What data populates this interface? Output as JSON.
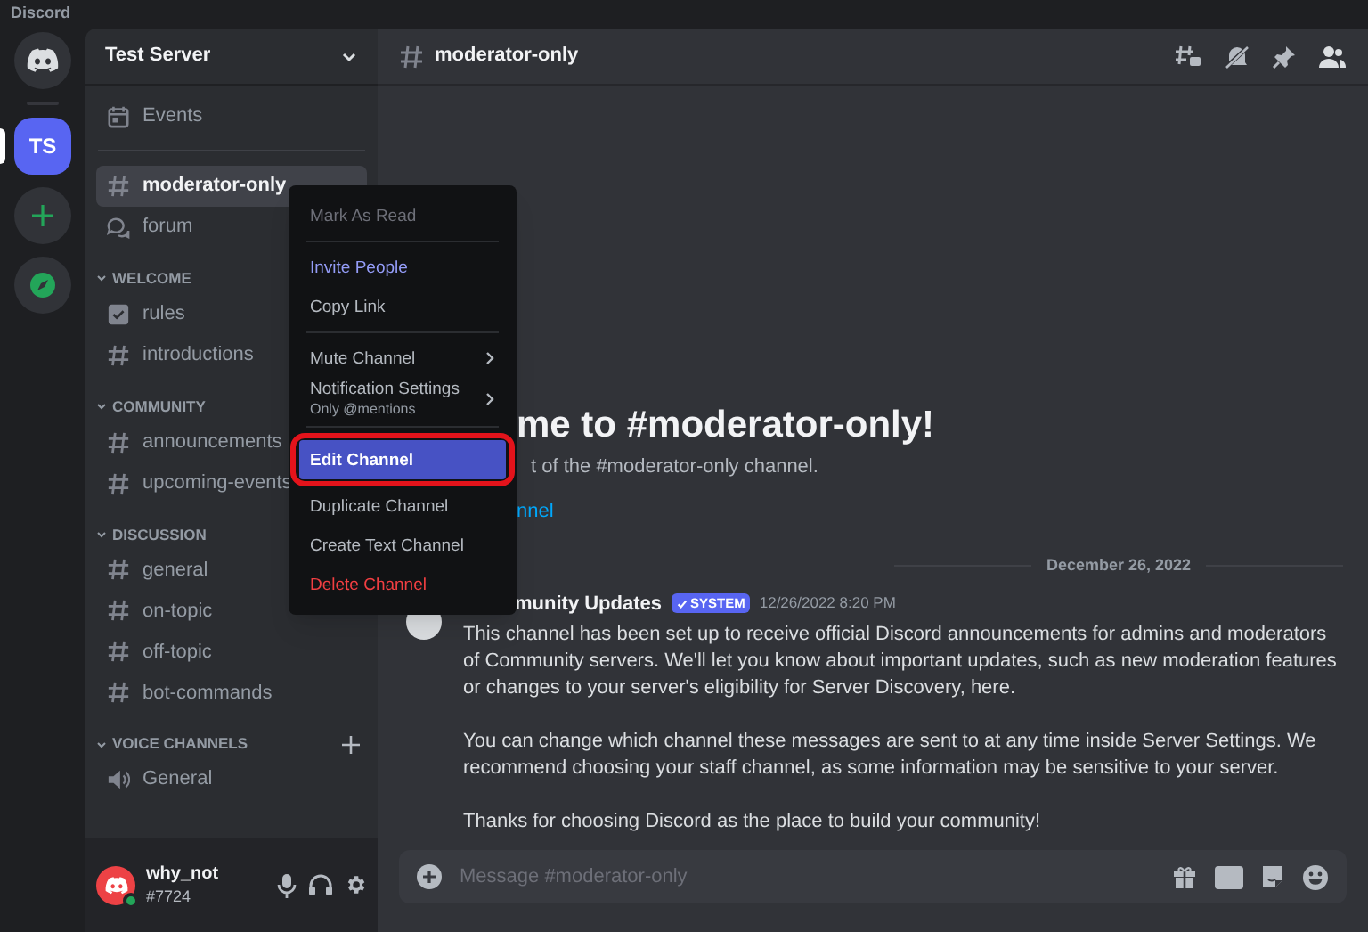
{
  "app_title": "Discord",
  "servers": [
    {
      "kind": "home",
      "selected": false
    },
    {
      "kind": "server",
      "label": "TS",
      "selected": true
    },
    {
      "kind": "add",
      "selected": false
    },
    {
      "kind": "explore",
      "selected": false
    }
  ],
  "server_name": "Test Server",
  "top_items": [
    {
      "kind": "events",
      "label": "Events"
    }
  ],
  "channels": [
    {
      "kind": "text",
      "label": "moderator-only",
      "selected": true
    },
    {
      "kind": "forum",
      "label": "forum",
      "selected": false
    }
  ],
  "categories": [
    {
      "label": "WELCOME",
      "channels": [
        {
          "kind": "rules",
          "label": "rules",
          "selected": false
        },
        {
          "kind": "text",
          "label": "introductions",
          "selected": false
        }
      ]
    },
    {
      "label": "COMMUNITY",
      "channels": [
        {
          "kind": "text",
          "label": "announcements",
          "selected": false
        },
        {
          "kind": "text",
          "label": "upcoming-events",
          "selected": false
        }
      ]
    },
    {
      "label": "DISCUSSION",
      "channels": [
        {
          "kind": "text",
          "label": "general",
          "selected": false
        },
        {
          "kind": "text",
          "label": "on-topic",
          "selected": false
        },
        {
          "kind": "text",
          "label": "off-topic",
          "selected": false
        },
        {
          "kind": "text",
          "label": "bot-commands",
          "selected": false
        }
      ]
    },
    {
      "label": "VOICE CHANNELS",
      "add": true,
      "channels": [
        {
          "kind": "voice",
          "label": "General",
          "selected": false
        }
      ]
    }
  ],
  "user": {
    "name": "why_not",
    "tag": "#7724",
    "online": true
  },
  "header": {
    "channel": "moderator-only"
  },
  "context_menu": {
    "groups": [
      [
        {
          "kind": "disabled",
          "label": "Mark As Read",
          "submenu": false,
          "selected": false,
          "circled": false
        }
      ],
      [
        {
          "kind": "accent",
          "label": "Invite People",
          "submenu": false,
          "selected": false,
          "circled": false
        },
        {
          "kind": "normal",
          "label": "Copy Link",
          "submenu": false,
          "selected": false,
          "circled": false
        }
      ],
      [
        {
          "kind": "normal",
          "label": "Mute Channel",
          "submenu": true,
          "selected": false,
          "circled": false
        },
        {
          "kind": "normal",
          "label": "Notification Settings",
          "sub": "Only @mentions",
          "submenu": true,
          "selected": false,
          "circled": false
        }
      ],
      [
        {
          "kind": "normal",
          "label": "Edit Channel",
          "submenu": false,
          "selected": true,
          "circled": true
        },
        {
          "kind": "normal",
          "label": "Duplicate Channel",
          "submenu": false,
          "selected": false,
          "circled": false
        },
        {
          "kind": "normal",
          "label": "Create Text Channel",
          "submenu": false,
          "selected": false,
          "circled": false
        },
        {
          "kind": "danger",
          "label": "Delete Channel",
          "submenu": false,
          "selected": false,
          "circled": false
        }
      ]
    ]
  },
  "welcome": {
    "heading": "me to #moderator-only!",
    "subtitle": "t of the #moderator-only channel.",
    "link": "nnel"
  },
  "date_divider": "December 26, 2022",
  "message": {
    "author": "munity Updates",
    "badge": "SYSTEM",
    "time": "12/26/2022 8:20 PM",
    "paragraphs": [
      "This channel has been set up to receive official Discord announcements for admins and moderators of Community servers. We'll let you know about important updates, such as new moderation features or changes to your server's eligibility for Server Discovery, here.",
      "You can change which channel these messages are sent to at any time inside Server Settings. We recommend choosing your staff channel, as some information may be sensitive to your server.",
      "Thanks for choosing Discord as the place to build your community!"
    ]
  },
  "composer": {
    "placeholder": "Message #moderator-only"
  }
}
